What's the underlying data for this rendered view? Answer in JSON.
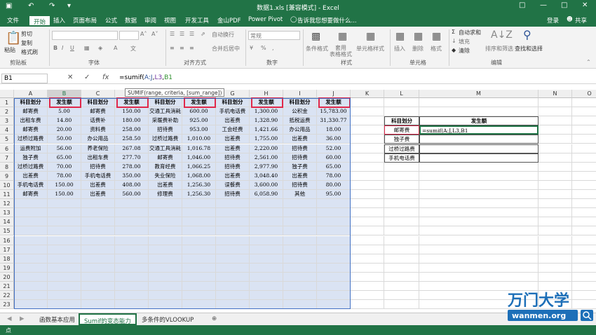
{
  "window": {
    "title": "数据1.xls [兼容模式] - Excel",
    "login": "登录",
    "share": "共享"
  },
  "menu": {
    "items": [
      "文件",
      "开始",
      "插入",
      "页面布局",
      "公式",
      "数据",
      "审阅",
      "视图",
      "开发工具",
      "金山PDF",
      "Power Pivot"
    ],
    "active_index": 1,
    "tell_me": "告诉我您想要做什么..."
  },
  "ribbon": {
    "clipboard": {
      "paste": "粘贴",
      "cut": "剪切",
      "copy": "复制",
      "format_painter": "格式刷",
      "group": "剪贴板"
    },
    "font": {
      "group": "字体",
      "bold": "B",
      "italic": "I",
      "underline": "U"
    },
    "alignment": {
      "wrap": "自动换行",
      "merge": "合并后居中",
      "group": "对齐方式"
    },
    "number": {
      "format": "常规",
      "group": "数字"
    },
    "styles": {
      "conditional": "条件格式",
      "table": "套用\n表格格式",
      "cell": "单元格样式",
      "group": "样式"
    },
    "cells": {
      "insert": "插入",
      "delete": "删除",
      "format": "格式",
      "group": "单元格"
    },
    "editing": {
      "autosum": "自动求和",
      "fill": "填充",
      "clear": "清除",
      "sort": "排序和筛选",
      "find": "查找和选择",
      "group": "编辑"
    }
  },
  "formula_bar": {
    "name_box": "B1",
    "cancel": "✕",
    "enter": "✓",
    "fx": "fx",
    "prefix": "=sumif(",
    "arg1": "A:J",
    "c1": ",",
    "arg2": "L3",
    "c2": ",",
    "arg3": "B1",
    "tooltip": "SUMIF(range, criteria, [sum_range])"
  },
  "columns": [
    "A",
    "B",
    "C",
    "D",
    "E",
    "F",
    "G",
    "H",
    "I",
    "J",
    "K",
    "L",
    "M",
    "N",
    "O"
  ],
  "rows": [
    "1",
    "2",
    "3",
    "4",
    "5",
    "6",
    "7",
    "8",
    "9",
    "10",
    "11",
    "12",
    "13",
    "14",
    "15",
    "16",
    "17",
    "18",
    "19",
    "20",
    "21",
    "22",
    "23"
  ],
  "table": {
    "header": [
      "科目划分",
      "发生额",
      "科目划分",
      "发生额",
      "科目划分",
      "发生额",
      "科目划分",
      "发生额",
      "科目划分",
      "发生额"
    ],
    "rows": [
      [
        "邮寄费",
        "5.00",
        "邮寄费",
        "150.00",
        "交通工具消耗",
        "600.00",
        "手机电话费",
        "1,300.00",
        "公积金",
        "15,783.00"
      ],
      [
        "出租车费",
        "14.80",
        "话费补",
        "180.00",
        "采暖费补助",
        "925.00",
        "出差费",
        "1,328.90",
        "抵税运费",
        "31,330.77"
      ],
      [
        "邮寄费",
        "20.00",
        "资料费",
        "258.00",
        "招待费",
        "953.00",
        "工会经费",
        "1,421.66",
        "办公用品",
        "18.00"
      ],
      [
        "过桥过路费",
        "50.00",
        "办公用品",
        "258.50",
        "过桥过路费",
        "1,010.00",
        "出差费",
        "1,755.00",
        "出差费",
        "36.00"
      ],
      [
        "运费附加",
        "56.00",
        "养老保险",
        "267.08",
        "交通工具消耗",
        "1,016.78",
        "出差费",
        "2,220.00",
        "招待费",
        "52.00"
      ],
      [
        "独子费",
        "65.00",
        "出租车费",
        "277.70",
        "邮寄费",
        "1,046.00",
        "招待费",
        "2,561.00",
        "招待费",
        "60.00"
      ],
      [
        "过桥过路费",
        "70.00",
        "招待费",
        "278.00",
        "教育经费",
        "1,066.25",
        "招待费",
        "2,977.90",
        "独子费",
        "65.00"
      ],
      [
        "出差费",
        "78.00",
        "手机电话费",
        "350.00",
        "失业保险",
        "1,068.00",
        "出差费",
        "3,048.40",
        "出差费",
        "78.00"
      ],
      [
        "手机电话费",
        "150.00",
        "出差费",
        "408.00",
        "出差费",
        "1,256.30",
        "误餐费",
        "3,600.00",
        "招待费",
        "80.00"
      ],
      [
        "邮寄费",
        "150.00",
        "出差费",
        "560.00",
        "修理费",
        "1,256.30",
        "招待费",
        "6,058.90",
        "其他",
        "95.00"
      ]
    ]
  },
  "summary": {
    "header_l": "科目划分",
    "header_m": "发生额",
    "items": [
      "邮寄费",
      "独子费",
      "过桥过路费",
      "手机电话费"
    ],
    "active_formula": "=sumif(A:J,L3,B1"
  },
  "sheets": [
    "函数基本应用",
    "Sumif的变态能力",
    "多条件的VLOOKUP"
  ],
  "active_sheet": 1,
  "status": {
    "mode": "点"
  },
  "logo": {
    "cn": "万门大学",
    "url": "wanmen.org"
  }
}
